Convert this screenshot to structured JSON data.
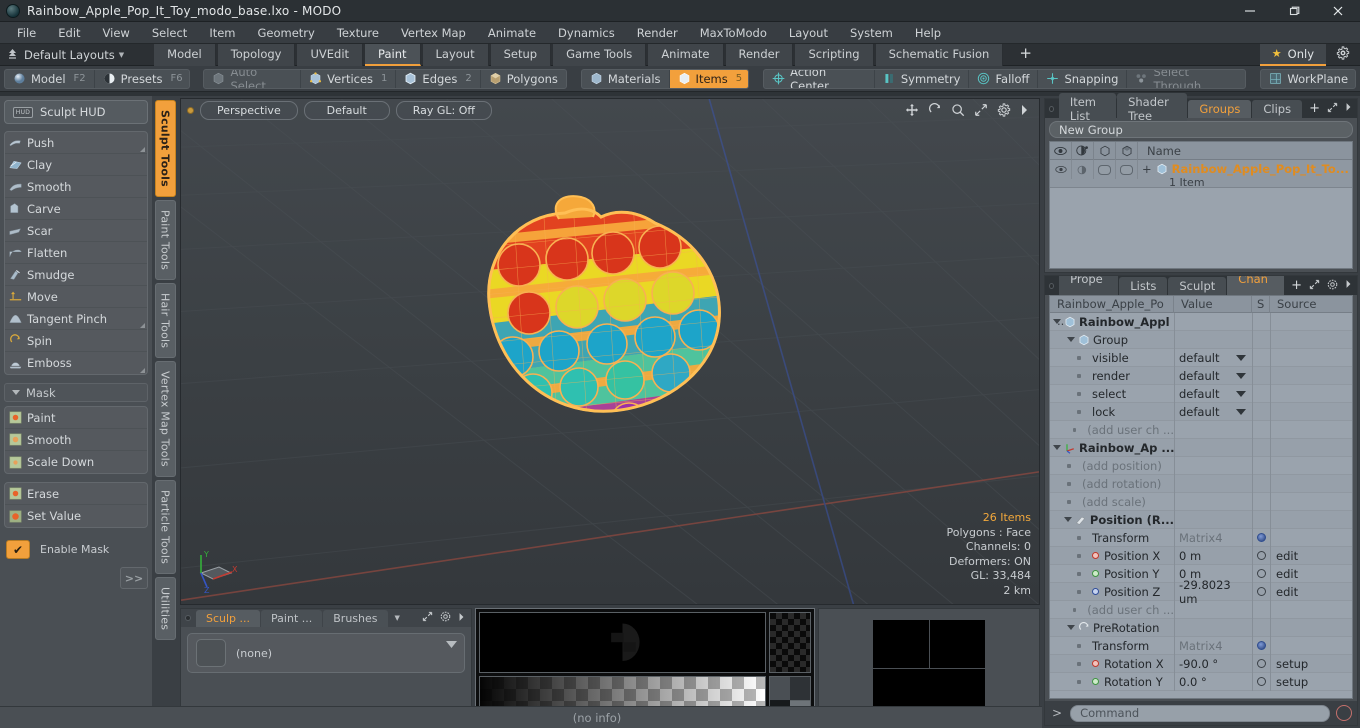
{
  "window": {
    "title": "Rainbow_Apple_Pop_It_Toy_modo_base.lxo - MODO",
    "minimize": "minimize-icon",
    "maximize": "maximize-icon",
    "close": "close-icon"
  },
  "menu": {
    "items": [
      "File",
      "Edit",
      "View",
      "Select",
      "Item",
      "Geometry",
      "Texture",
      "Vertex Map",
      "Animate",
      "Dynamics",
      "Render",
      "MaxToModo",
      "Layout",
      "System",
      "Help"
    ]
  },
  "layout_bar": {
    "layouts_label": "Default Layouts",
    "tabs": [
      {
        "label": "Model",
        "active": false
      },
      {
        "label": "Topology",
        "active": false
      },
      {
        "label": "UVEdit",
        "active": false
      },
      {
        "label": "Paint",
        "active": true
      },
      {
        "label": "Layout",
        "active": false
      },
      {
        "label": "Setup",
        "active": false
      },
      {
        "label": "Game Tools",
        "active": false
      },
      {
        "label": "Animate",
        "active": false
      },
      {
        "label": "Render",
        "active": false
      },
      {
        "label": "Scripting",
        "active": false
      },
      {
        "label": "Schematic Fusion",
        "active": false
      }
    ],
    "add_tab": "+",
    "only_label": "Only"
  },
  "mode_bar": {
    "group1": [
      {
        "label": "Model",
        "key": "F2",
        "active": false,
        "dim": false
      },
      {
        "label": "Presets",
        "key": "F6",
        "active": false,
        "dim": false
      }
    ],
    "group2": [
      {
        "label": "Auto Select",
        "key": "",
        "active": false,
        "dim": true
      },
      {
        "label": "Vertices",
        "key": "1",
        "active": false,
        "dim": false
      },
      {
        "label": "Edges",
        "key": "2",
        "active": false,
        "dim": false
      },
      {
        "label": "Polygons",
        "key": "",
        "active": false,
        "dim": false
      }
    ],
    "group3": [
      {
        "label": "Materials",
        "key": "",
        "active": false,
        "dim": false
      },
      {
        "label": "Items",
        "key": "5",
        "active": true,
        "dim": false
      }
    ],
    "group4": [
      {
        "label": "Action Center",
        "key": "",
        "active": false,
        "dim": false
      },
      {
        "label": "Symmetry",
        "key": "",
        "active": false,
        "dim": false
      },
      {
        "label": "Falloff",
        "key": "",
        "active": false,
        "dim": false
      },
      {
        "label": "Snapping",
        "key": "",
        "active": false,
        "dim": false
      },
      {
        "label": "Select Through",
        "key": "",
        "active": false,
        "dim": true
      }
    ],
    "group5": [
      {
        "label": "WorkPlane",
        "key": "",
        "active": false,
        "dim": false
      }
    ]
  },
  "left_panel": {
    "hud_label": "Sculpt HUD",
    "hud_badge": "HUD",
    "tools": [
      {
        "label": "Push",
        "corner": true
      },
      {
        "label": "Clay",
        "corner": false
      },
      {
        "label": "Smooth",
        "corner": false
      },
      {
        "label": "Carve",
        "corner": false
      },
      {
        "label": "Scar",
        "corner": false
      },
      {
        "label": "Flatten",
        "corner": false
      },
      {
        "label": "Smudge",
        "corner": false
      },
      {
        "label": "Move",
        "corner": false
      },
      {
        "label": "Tangent Pinch",
        "corner": true
      },
      {
        "label": "Spin",
        "corner": false
      },
      {
        "label": "Emboss",
        "corner": true
      }
    ],
    "mask_header": "Mask",
    "mask_tools_a": [
      "Paint",
      "Smooth",
      "Scale Down"
    ],
    "mask_tools_b": [
      "Erase",
      "Set Value"
    ],
    "enable_mask_label": "Enable Mask",
    "expand_label": ">>"
  },
  "vertical_tabs": [
    {
      "label": "Sculpt Tools",
      "active": true
    },
    {
      "label": "Paint Tools",
      "active": false
    },
    {
      "label": "Hair Tools",
      "active": false
    },
    {
      "label": "Vertex Map Tools",
      "active": false
    },
    {
      "label": "Particle Tools",
      "active": false
    },
    {
      "label": "Utilities",
      "active": false
    }
  ],
  "viewport": {
    "view_mode": "Perspective",
    "shading": "Default",
    "raygl": "Ray GL: Off",
    "icons": [
      "move-icon",
      "rotate-icon",
      "zoom-icon",
      "fit-icon",
      "gear-icon",
      "chevron-right-icon"
    ],
    "stats": {
      "items": "26 Items",
      "polygons": "Polygons : Face",
      "channels": "Channels: 0",
      "deformers": "Deformers: ON",
      "gl": "GL: 33,484",
      "scale": "2 km"
    },
    "axis": {
      "x": "X",
      "y": "Y",
      "z": "Z"
    },
    "model_name": "Rainbow Apple Pop It Toy wireframe"
  },
  "bottom_left_panel": {
    "tabs": [
      {
        "label": "Sculp ...",
        "active": true
      },
      {
        "label": "Paint ...",
        "active": false
      },
      {
        "label": "Brushes",
        "active": false
      }
    ],
    "preset_value": "(none)"
  },
  "right_panel": {
    "top_tabs": [
      {
        "label": "Item List",
        "active": false
      },
      {
        "label": "Shader Tree",
        "active": false
      },
      {
        "label": "Groups",
        "active": true
      },
      {
        "label": "Clips",
        "active": false
      }
    ],
    "top_add": "+",
    "new_group_label": "New Group",
    "list_columns": [
      "eye-icon",
      "render-icon",
      "lock-icon",
      "select-icon",
      "Name"
    ],
    "group_row": {
      "name": "Rainbow_Apple_Pop_It_To...",
      "subtitle": "1 Item",
      "expander": "+"
    },
    "bottom_tabs": [
      {
        "label": "Prope ...",
        "active": false
      },
      {
        "label": "Lists",
        "active": false
      },
      {
        "label": "Sculpt",
        "active": false
      },
      {
        "label": "Chan ...",
        "active": true
      }
    ],
    "bottom_add": "+",
    "channel_columns": [
      "Rainbow_Apple_Po ...",
      "Value",
      "S",
      "Source"
    ],
    "channels": [
      {
        "indent": 0,
        "icon": "triangle-down",
        "type": "cube",
        "label": "Rainbow_Appl ...",
        "value": "",
        "s": "",
        "source": "",
        "bold": true
      },
      {
        "indent": 1,
        "icon": "triangle-down",
        "type": "cube",
        "label": "Group",
        "value": "",
        "s": "",
        "source": "",
        "bold": false
      },
      {
        "indent": 2,
        "icon": "dot",
        "type": "",
        "label": "visible",
        "value": "default",
        "s": "",
        "source": "",
        "dropdown": true
      },
      {
        "indent": 2,
        "icon": "dot",
        "type": "",
        "label": "render",
        "value": "default",
        "s": "",
        "source": "",
        "dropdown": true
      },
      {
        "indent": 2,
        "icon": "dot",
        "type": "",
        "label": "select",
        "value": "default",
        "s": "",
        "source": "",
        "dropdown": true
      },
      {
        "indent": 2,
        "icon": "dot",
        "type": "",
        "label": "lock",
        "value": "default",
        "s": "",
        "source": "",
        "dropdown": true
      },
      {
        "indent": 2,
        "icon": "dot",
        "type": "",
        "label": "(add user ch ...",
        "value": "",
        "s": "",
        "source": "",
        "muted": true
      },
      {
        "indent": 0,
        "icon": "triangle-down",
        "type": "axis",
        "label": "Rainbow_Ap ...",
        "value": "",
        "s": "",
        "source": "",
        "bold": true
      },
      {
        "indent": 1,
        "icon": "dot",
        "type": "",
        "label": "(add position)",
        "value": "",
        "s": "",
        "source": "",
        "muted": true
      },
      {
        "indent": 1,
        "icon": "dot",
        "type": "",
        "label": "(add rotation)",
        "value": "",
        "s": "",
        "source": "",
        "muted": true
      },
      {
        "indent": 1,
        "icon": "dot",
        "type": "",
        "label": "(add scale)",
        "value": "",
        "s": "",
        "source": "",
        "muted": true
      },
      {
        "indent": 1,
        "icon": "triangle-down",
        "type": "pos",
        "label": "Position (R...",
        "value": "",
        "s": "",
        "source": "",
        "bold": true
      },
      {
        "indent": 2,
        "icon": "dot",
        "type": "",
        "label": "Transform",
        "value": "Matrix4",
        "s": "gear",
        "source": "",
        "valmuted": true
      },
      {
        "indent": 2,
        "icon": "dot",
        "type": "red",
        "label": "Position X",
        "value": "0 m",
        "s": "circle",
        "source": "edit"
      },
      {
        "indent": 2,
        "icon": "dot",
        "type": "green",
        "label": "Position Y",
        "value": "0 m",
        "s": "circle",
        "source": "edit"
      },
      {
        "indent": 2,
        "icon": "dot",
        "type": "blue",
        "label": "Position Z",
        "value": "-29.8023 um",
        "s": "circle",
        "source": "edit"
      },
      {
        "indent": 2,
        "icon": "dot",
        "type": "",
        "label": "(add user ch ...",
        "value": "",
        "s": "",
        "source": "",
        "muted": true
      },
      {
        "indent": 1,
        "icon": "triangle-down",
        "type": "rot",
        "label": "PreRotation",
        "value": "",
        "s": "",
        "source": "",
        "bold": false
      },
      {
        "indent": 2,
        "icon": "dot",
        "type": "",
        "label": "Transform",
        "value": "Matrix4",
        "s": "gear",
        "source": "",
        "valmuted": true
      },
      {
        "indent": 2,
        "icon": "dot",
        "type": "red",
        "label": "Rotation X",
        "value": "-90.0 °",
        "s": "circle",
        "source": "setup"
      },
      {
        "indent": 2,
        "icon": "dot",
        "type": "green",
        "label": "Rotation Y",
        "value": "0.0 °",
        "s": "circle",
        "source": "setup"
      }
    ],
    "command": {
      "prompt": ">",
      "placeholder": "Command",
      "record": "record-icon"
    }
  },
  "status_bar": {
    "text": "(no info)"
  },
  "colors": {
    "accent": "#f2a03c",
    "panel_bg": "#4a4f54",
    "window_bg": "#3a3f44",
    "list_bg": "#9aa3ad",
    "title_bg": "#2b3034"
  }
}
